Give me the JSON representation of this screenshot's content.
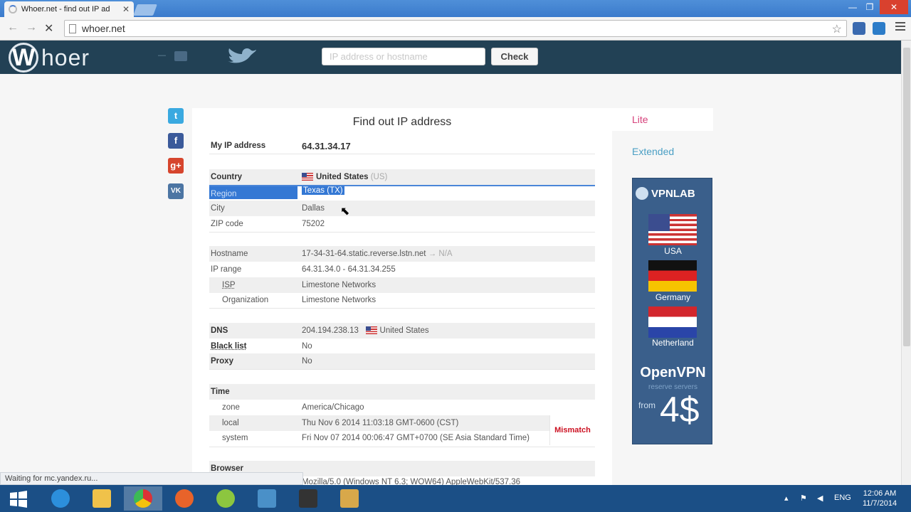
{
  "browser": {
    "tab_title": "Whoer.net - find out IP ad",
    "url": "whoer.net",
    "window_controls": [
      "minimize",
      "maximize",
      "close"
    ]
  },
  "header": {
    "logo_text": "hoer",
    "logo_letter": "W",
    "lang": "eng",
    "search_placeholder": "IP address or hostname",
    "check_label": "Check"
  },
  "social": [
    "twitter",
    "facebook",
    "google-plus",
    "vk"
  ],
  "social_labels": {
    "twitter": "t",
    "facebook": "f",
    "google_plus": "g+",
    "vk": "VK"
  },
  "main": {
    "title": "Find out IP address",
    "my_ip_label": "My IP address",
    "my_ip_value": "64.31.34.17",
    "country_label": "Country",
    "country_value": "United States",
    "country_code": "(US)",
    "region_label": "Region",
    "region_value": "Texas (TX)",
    "city_label": "City",
    "city_value": "Dallas",
    "zip_label": "ZIP code",
    "zip_value": "75202",
    "hostname_label": "Hostname",
    "hostname_value": "17-34-31-64.static.reverse.lstn.net",
    "hostname_suffix": "→ N/A",
    "iprange_label": "IP range",
    "iprange_value": "64.31.34.0 - 64.31.34.255",
    "isp_label": "ISP",
    "isp_value": "Limestone Networks",
    "org_label": "Organization",
    "org_value": "Limestone Networks",
    "dns_label": "DNS",
    "dns_value": "204.194.238.13",
    "dns_country": "United States",
    "blacklist_label": "Black list",
    "blacklist_value": "No",
    "proxy_label": "Proxy",
    "proxy_value": "No",
    "time_label": "Time",
    "zone_label": "zone",
    "zone_value": "America/Chicago",
    "local_label": "local",
    "local_value": "Thu Nov 6 2014 11:03:18 GMT-0600 (CST)",
    "system_label": "system",
    "system_value": "Fri Nov 07 2014 00:06:47 GMT+0700 (SE Asia Standard Time)",
    "mismatch_label": "Mismatch",
    "browser_label": "Browser",
    "useragent_value": "Mozilla/5.0 (Windows NT 6.3; WOW64) AppleWebKit/537.36"
  },
  "side": {
    "lite_label": "Lite",
    "extended_label": "Extended"
  },
  "ad": {
    "brand": "VPNLAB",
    "countries": [
      "USA",
      "Germany",
      "Netherland"
    ],
    "headline": "OpenVPN",
    "subline": "reserve servers",
    "from_label": "from",
    "price": "4$"
  },
  "status_text": "Waiting for mc.yandex.ru...",
  "taskbar": {
    "lang": "ENG",
    "time": "12:06 AM",
    "date": "11/7/2014"
  },
  "colors": {
    "header_bg": "#224155",
    "lite_pink": "#d6407a",
    "extended_blue": "#4a9fc4",
    "mismatch_red": "#cc1122",
    "selection_blue": "#3478d4"
  }
}
